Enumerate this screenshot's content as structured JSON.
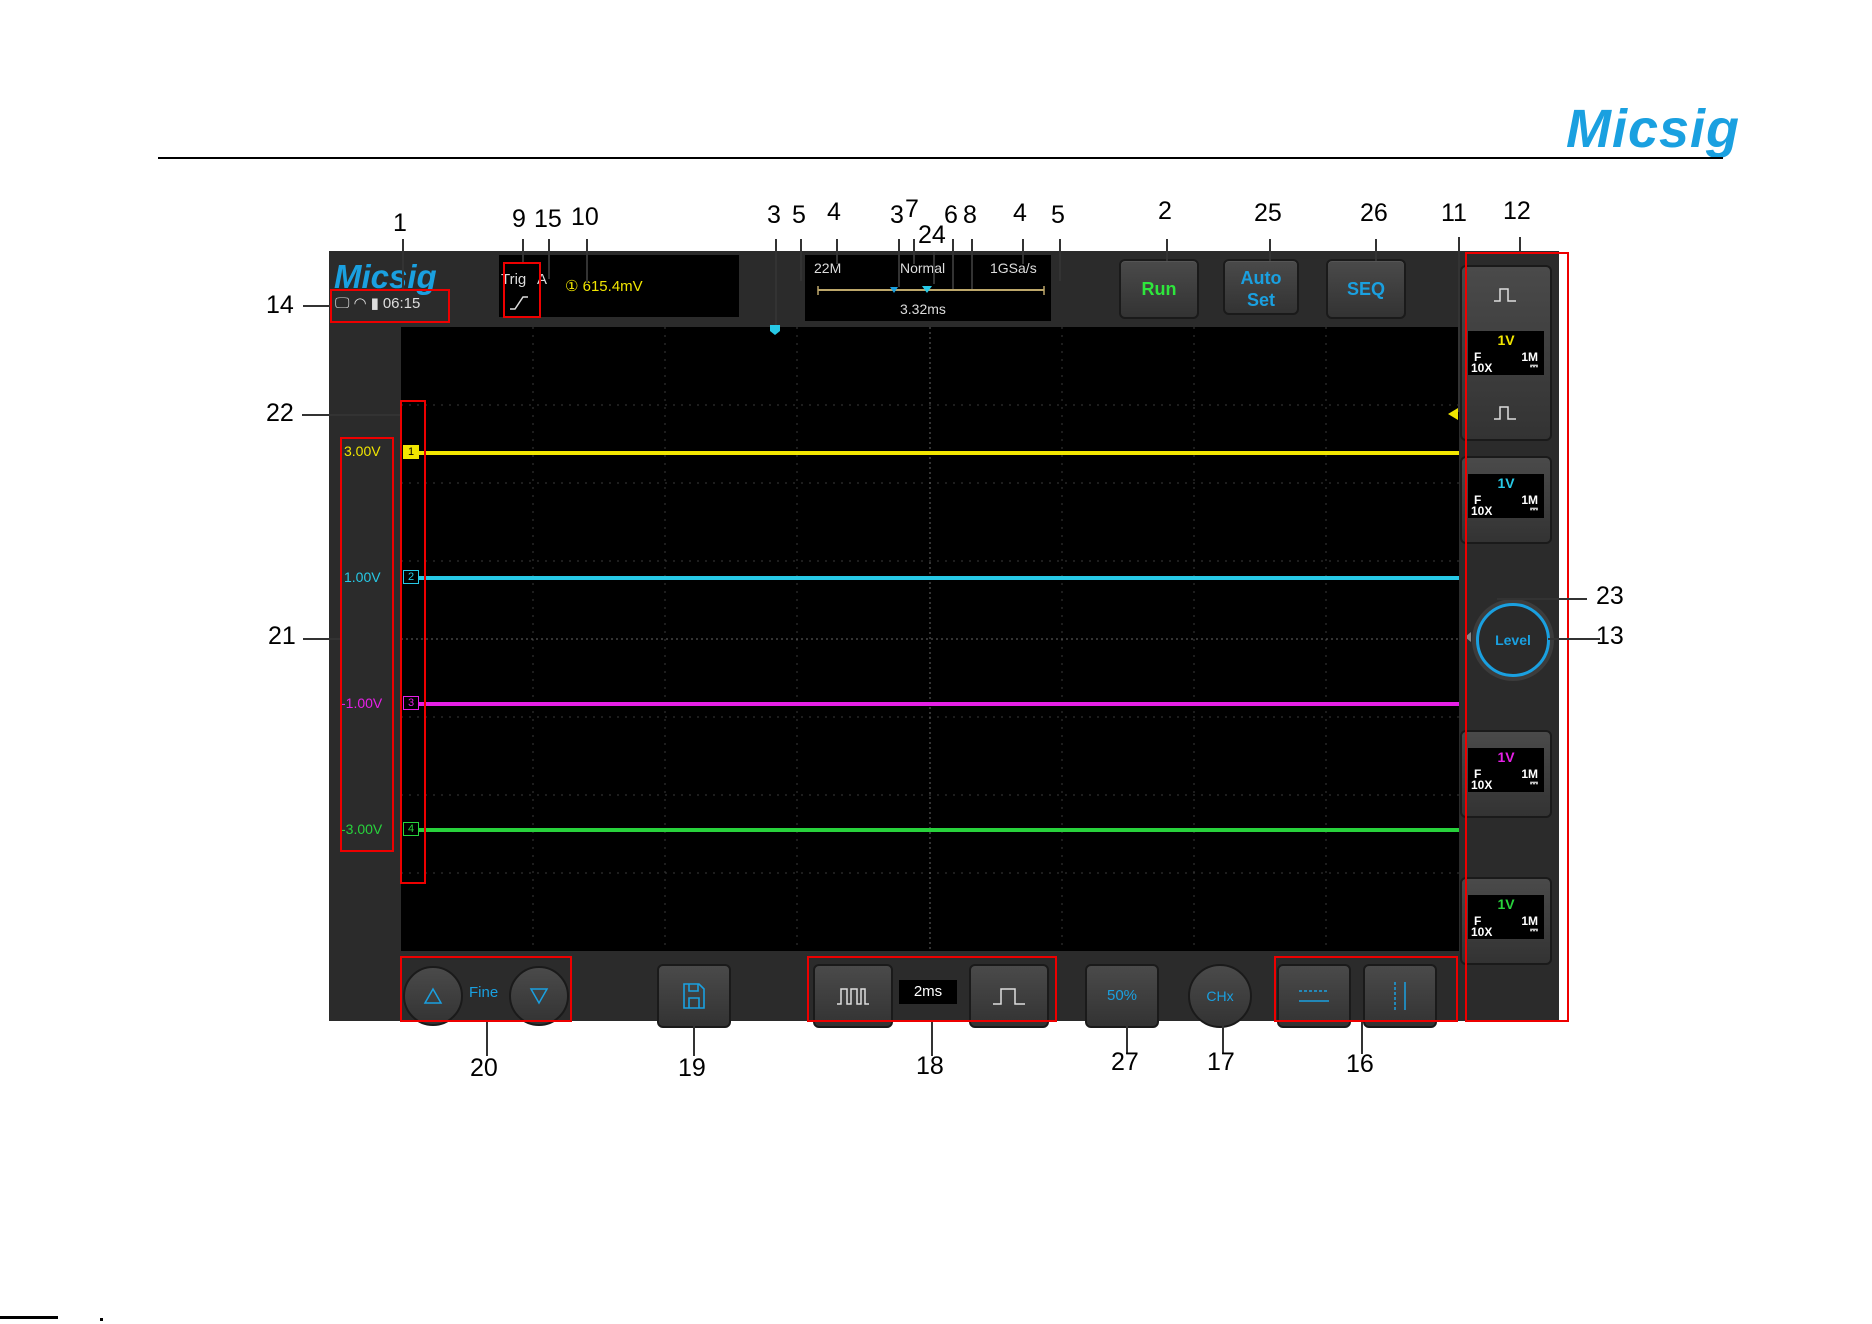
{
  "doc": {
    "brand": "Micsig"
  },
  "scope": {
    "brand": "Micsig",
    "status": {
      "time": "06:15"
    },
    "trigger": {
      "label": "Trig",
      "mode_code": "A",
      "source_glyph": "①",
      "level": "615.4mV"
    },
    "timebase": {
      "memory_depth": "22M",
      "acquire_mode": "Normal",
      "sample_rate": "1GSa/s",
      "delay": "3.32ms"
    },
    "buttons": {
      "run": "Run",
      "auto_line1": "Auto",
      "auto_line2": "Set",
      "seq": "SEQ",
      "level": "Level",
      "fine": "Fine",
      "timebase_value": "2ms",
      "half": "50%",
      "chx": "CHx"
    },
    "channels": [
      {
        "id": "1",
        "offset": "3.00V",
        "color": "#f2e600",
        "scale": "1V",
        "coupling": "F",
        "probe": "10X",
        "impedance": "1M"
      },
      {
        "id": "2",
        "offset": "1.00V",
        "color": "#27c9e6",
        "scale": "1V",
        "coupling": "F",
        "probe": "10X",
        "impedance": "1M"
      },
      {
        "id": "3",
        "offset": "-1.00V",
        "color": "#e620e6",
        "scale": "1V",
        "coupling": "F",
        "probe": "10X",
        "impedance": "1M"
      },
      {
        "id": "4",
        "offset": "-3.00V",
        "color": "#28d23c",
        "scale": "1V",
        "coupling": "F",
        "probe": "10X",
        "impedance": "1M"
      }
    ]
  },
  "callouts": {
    "n1": "1",
    "n2": "2",
    "n3a": "3",
    "n3b": "3",
    "n4a": "4",
    "n4b": "4",
    "n5a": "5",
    "n5b": "5",
    "n6": "6",
    "n7": "7",
    "n8": "8",
    "n9": "9",
    "n10": "10",
    "n11": "11",
    "n12": "12",
    "n13": "13",
    "n14": "14",
    "n15": "15",
    "n16": "16",
    "n17": "17",
    "n18": "18",
    "n19": "19",
    "n20": "20",
    "n21": "21",
    "n22": "22",
    "n23": "23",
    "n24": "24",
    "n25": "25",
    "n26": "26",
    "n27": "27"
  }
}
